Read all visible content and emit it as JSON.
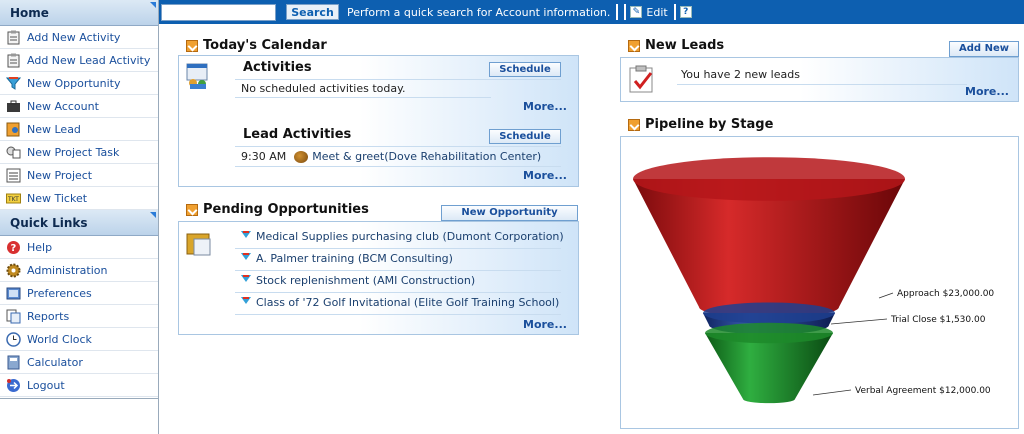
{
  "sidebar": {
    "home_label": "Home",
    "home_items": [
      {
        "label": "Add New Activity",
        "icon": "clipboard-icon"
      },
      {
        "label": "Add New Lead Activity",
        "icon": "clipboard-icon"
      },
      {
        "label": "New Opportunity",
        "icon": "funnel-icon"
      },
      {
        "label": "New Account",
        "icon": "briefcase-icon"
      },
      {
        "label": "New Lead",
        "icon": "lead-icon"
      },
      {
        "label": "New Project Task",
        "icon": "task-icon"
      },
      {
        "label": "New Project",
        "icon": "project-icon"
      },
      {
        "label": "New Ticket",
        "icon": "ticket-icon"
      }
    ],
    "quick_links_label": "Quick Links",
    "quick_items": [
      {
        "label": "Help",
        "icon": "help-icon"
      },
      {
        "label": "Administration",
        "icon": "gear-icon"
      },
      {
        "label": "Preferences",
        "icon": "preferences-icon"
      },
      {
        "label": "Reports",
        "icon": "reports-icon"
      },
      {
        "label": "World Clock",
        "icon": "clock-icon"
      },
      {
        "label": "Calculator",
        "icon": "calculator-icon"
      },
      {
        "label": "Logout",
        "icon": "logout-icon"
      }
    ]
  },
  "topbar": {
    "search_value": "",
    "search_button": "Search",
    "search_hint": "Perform a quick search for Account information.",
    "edit_label": "Edit",
    "help_glyph": "?"
  },
  "calendar": {
    "title": "Today's Calendar",
    "activities_title": "Activities",
    "schedule_label": "Schedule",
    "activities_empty": "No scheduled activities today.",
    "more_label": "More...",
    "lead_activities_title": "Lead Activities",
    "lead_time": "9:30 AM",
    "lead_item": "Meet & greet(Dove Rehabilitation Center)"
  },
  "opportunities": {
    "title": "Pending Opportunities",
    "new_button": "New Opportunity",
    "items": [
      "Medical Supplies purchasing club  (Dumont Corporation)",
      "A. Palmer training  (BCM Consulting)",
      "Stock replenishment  (AMI Construction)",
      "Class of '72 Golf Invitational  (Elite Golf Training School)"
    ],
    "more_label": "More..."
  },
  "leads": {
    "title": "New Leads",
    "add_button": "Add New",
    "message": "You have 2 new leads",
    "more_label": "More..."
  },
  "pipeline": {
    "title": "Pipeline by Stage"
  },
  "chart_data": {
    "type": "funnel",
    "title": "",
    "categories": [
      "Approach",
      "Trial Close",
      "Verbal Agreement"
    ],
    "values": [
      23000,
      1530,
      12000
    ],
    "labels": [
      "Approach $23,000.00",
      "Trial Close $1,530.00",
      "Verbal Agreement $12,000.00"
    ],
    "colors": [
      "#b5161a",
      "#1f3f8f",
      "#1d8a2a"
    ]
  }
}
